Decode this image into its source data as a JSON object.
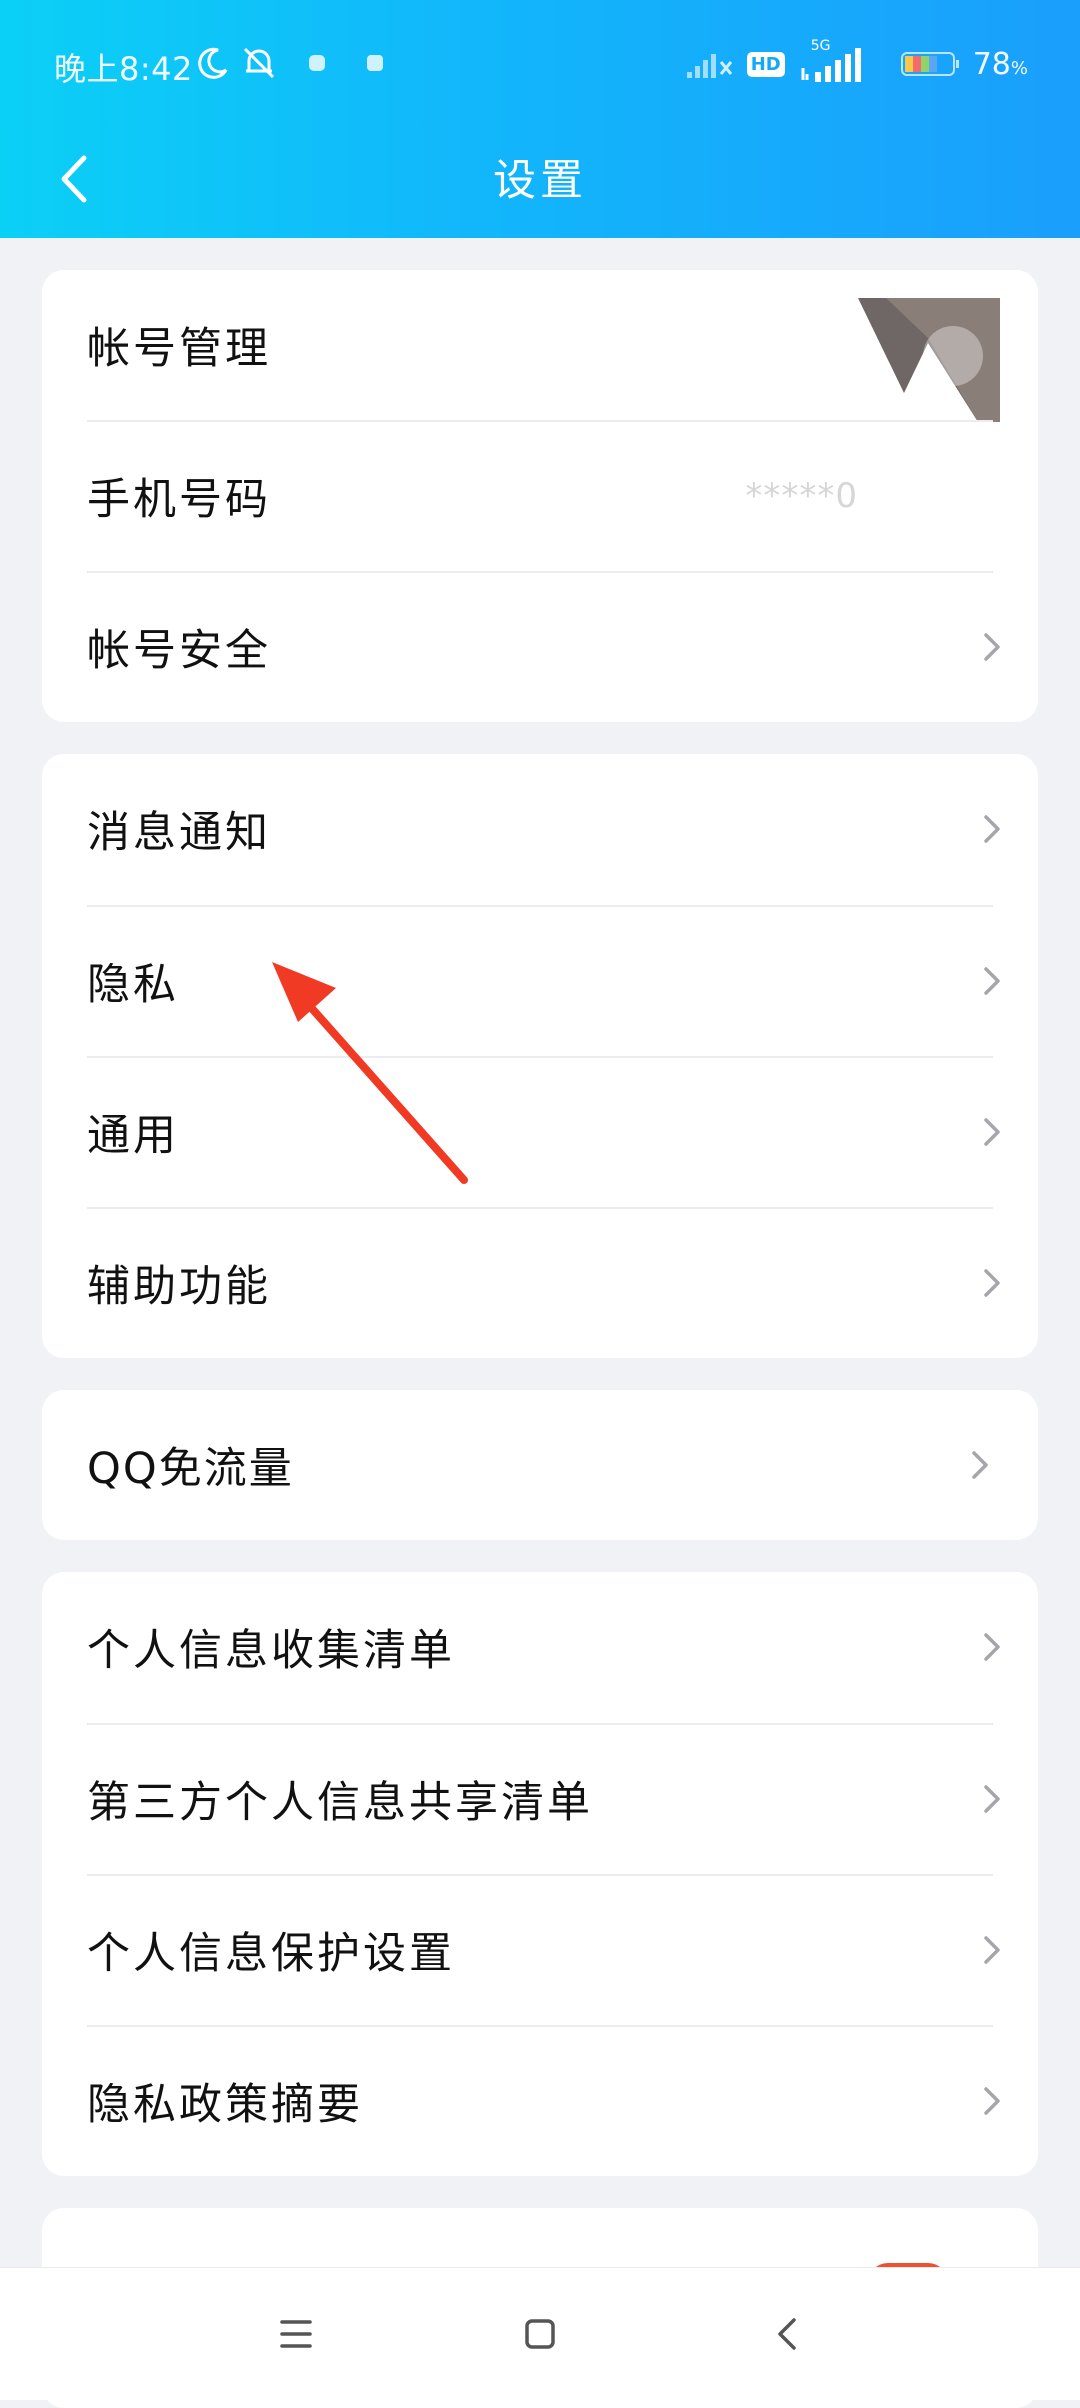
{
  "status_bar": {
    "time": "晚上8:42",
    "battery": "78",
    "battery_unit": "%",
    "network_badge": "HD",
    "network_type": "5G"
  },
  "header": {
    "title": "设置"
  },
  "groups": [
    {
      "rows": [
        {
          "label": "帐号管理"
        },
        {
          "label": "手机号码",
          "value": "*****0"
        },
        {
          "label": "帐号安全"
        }
      ]
    },
    {
      "rows": [
        {
          "label": "消息通知"
        },
        {
          "label": "隐私"
        },
        {
          "label": "通用"
        },
        {
          "label": "辅助功能"
        }
      ]
    },
    {
      "rows": [
        {
          "label": "QQ免流量"
        }
      ]
    },
    {
      "rows": [
        {
          "label": "个人信息收集清单"
        },
        {
          "label": "第三方个人信息共享清单"
        },
        {
          "label": "个人信息保护设置"
        },
        {
          "label": "隐私政策摘要"
        }
      ]
    }
  ],
  "colors": {
    "header_start": "#0bd0f6",
    "header_end": "#1a9ffc",
    "annotation_arrow": "#f03a24",
    "badge": "#f1502f"
  },
  "icons": {
    "back": "chevron-left-icon",
    "row_arrow": "chevron-right-icon",
    "nav_menu": "menu-icon",
    "nav_home": "home-square-icon",
    "nav_back": "back-triangle-icon"
  }
}
